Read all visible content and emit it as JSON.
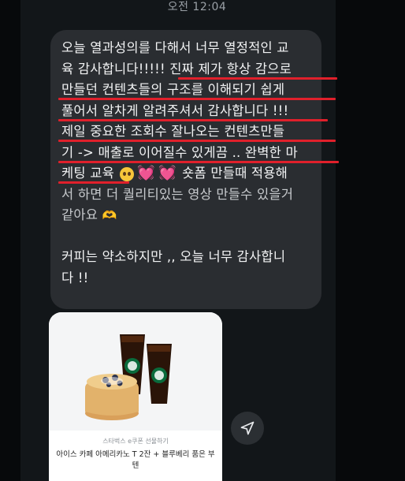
{
  "status": {
    "time": "오전 12:04"
  },
  "message": {
    "lines": [
      "오늘 열과성의를 다해서 너무 열정적인 교",
      "육 감사합니다!!!!! 진짜 제가 항상 감으로",
      "만들던 컨텐츠들의 구조를 이해되기 쉽게",
      "풀어서 알차게 알려주셔서 감사합니다 !!!",
      "제일 중요한 조회수 잘나오는 컨텐츠만들",
      "기 -> 매출로 이어질수 있게끔 .. 완벽한 마",
      "케팅 교육",
      "숏폼 만들때 적용해",
      "서 하면 더 퀄리티있는 영상 만들수 있을거",
      "같아요",
      "커피는 약소하지만 ,, 오늘 너무 감사합니",
      "다 !!"
    ],
    "emojis": {
      "pleading_face": "pleading-face-emoji",
      "heart_1": "💓",
      "heart_2": "💓",
      "heart_hands": "🫶"
    },
    "highlight_color": "#e0202b"
  },
  "gift_card": {
    "subtitle": "스타벅스 e쿠폰 선물하기",
    "title_line1": "아이스 카페 아메리카노 T 2잔 + 블루베리 품은 부",
    "title_line2": "텐"
  },
  "share_button": {
    "icon": "send-icon"
  }
}
